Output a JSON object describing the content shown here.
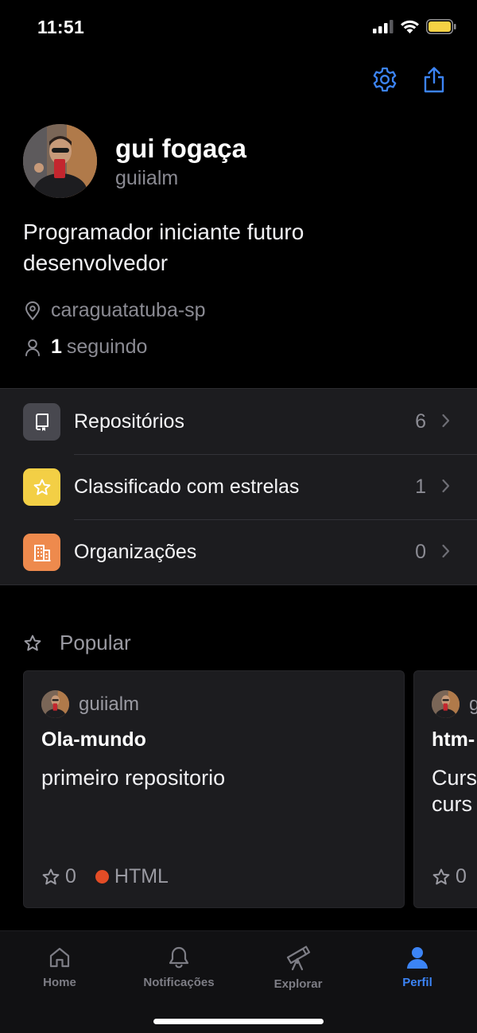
{
  "status_bar": {
    "time": "11:51",
    "icons": [
      "cellular-signal-icon",
      "wifi-icon",
      "battery-icon"
    ],
    "battery_color": "#f5d145"
  },
  "header_actions": [
    "settings-gear-icon",
    "share-icon"
  ],
  "profile": {
    "name": "gui fogaça",
    "username": "guiialm",
    "bio": "Programador iniciante futuro desenvolvedor",
    "location": "caraguatatuba-sp",
    "following_count": "1",
    "following_label": "seguindo"
  },
  "menu": {
    "items": [
      {
        "label": "Repositórios",
        "count": "6",
        "icon": "repo-icon",
        "icon_bg": "#48484f"
      },
      {
        "label": "Classificado com estrelas",
        "count": "1",
        "icon": "star-icon",
        "icon_bg": "#f3cf45"
      },
      {
        "label": "Organizações",
        "count": "0",
        "icon": "organization-icon",
        "icon_bg": "#ee8a4d"
      }
    ]
  },
  "popular": {
    "title": "Popular",
    "cards": [
      {
        "owner": "guiialm",
        "title": "Ola-mundo",
        "description": "primeiro repositorio",
        "stars": "0",
        "language": "HTML",
        "language_color": "#e34c26"
      },
      {
        "owner": "g",
        "title": "htm-",
        "description": "Curs curs",
        "stars": "0"
      }
    ]
  },
  "tabbar": {
    "tabs": [
      {
        "label": "Home",
        "icon": "home-icon"
      },
      {
        "label": "Notificações",
        "icon": "bell-icon"
      },
      {
        "label": "Explorar",
        "icon": "telescope-icon"
      },
      {
        "label": "Perfil",
        "icon": "person-icon",
        "active": true
      }
    ],
    "accent": "#3c84f5"
  }
}
